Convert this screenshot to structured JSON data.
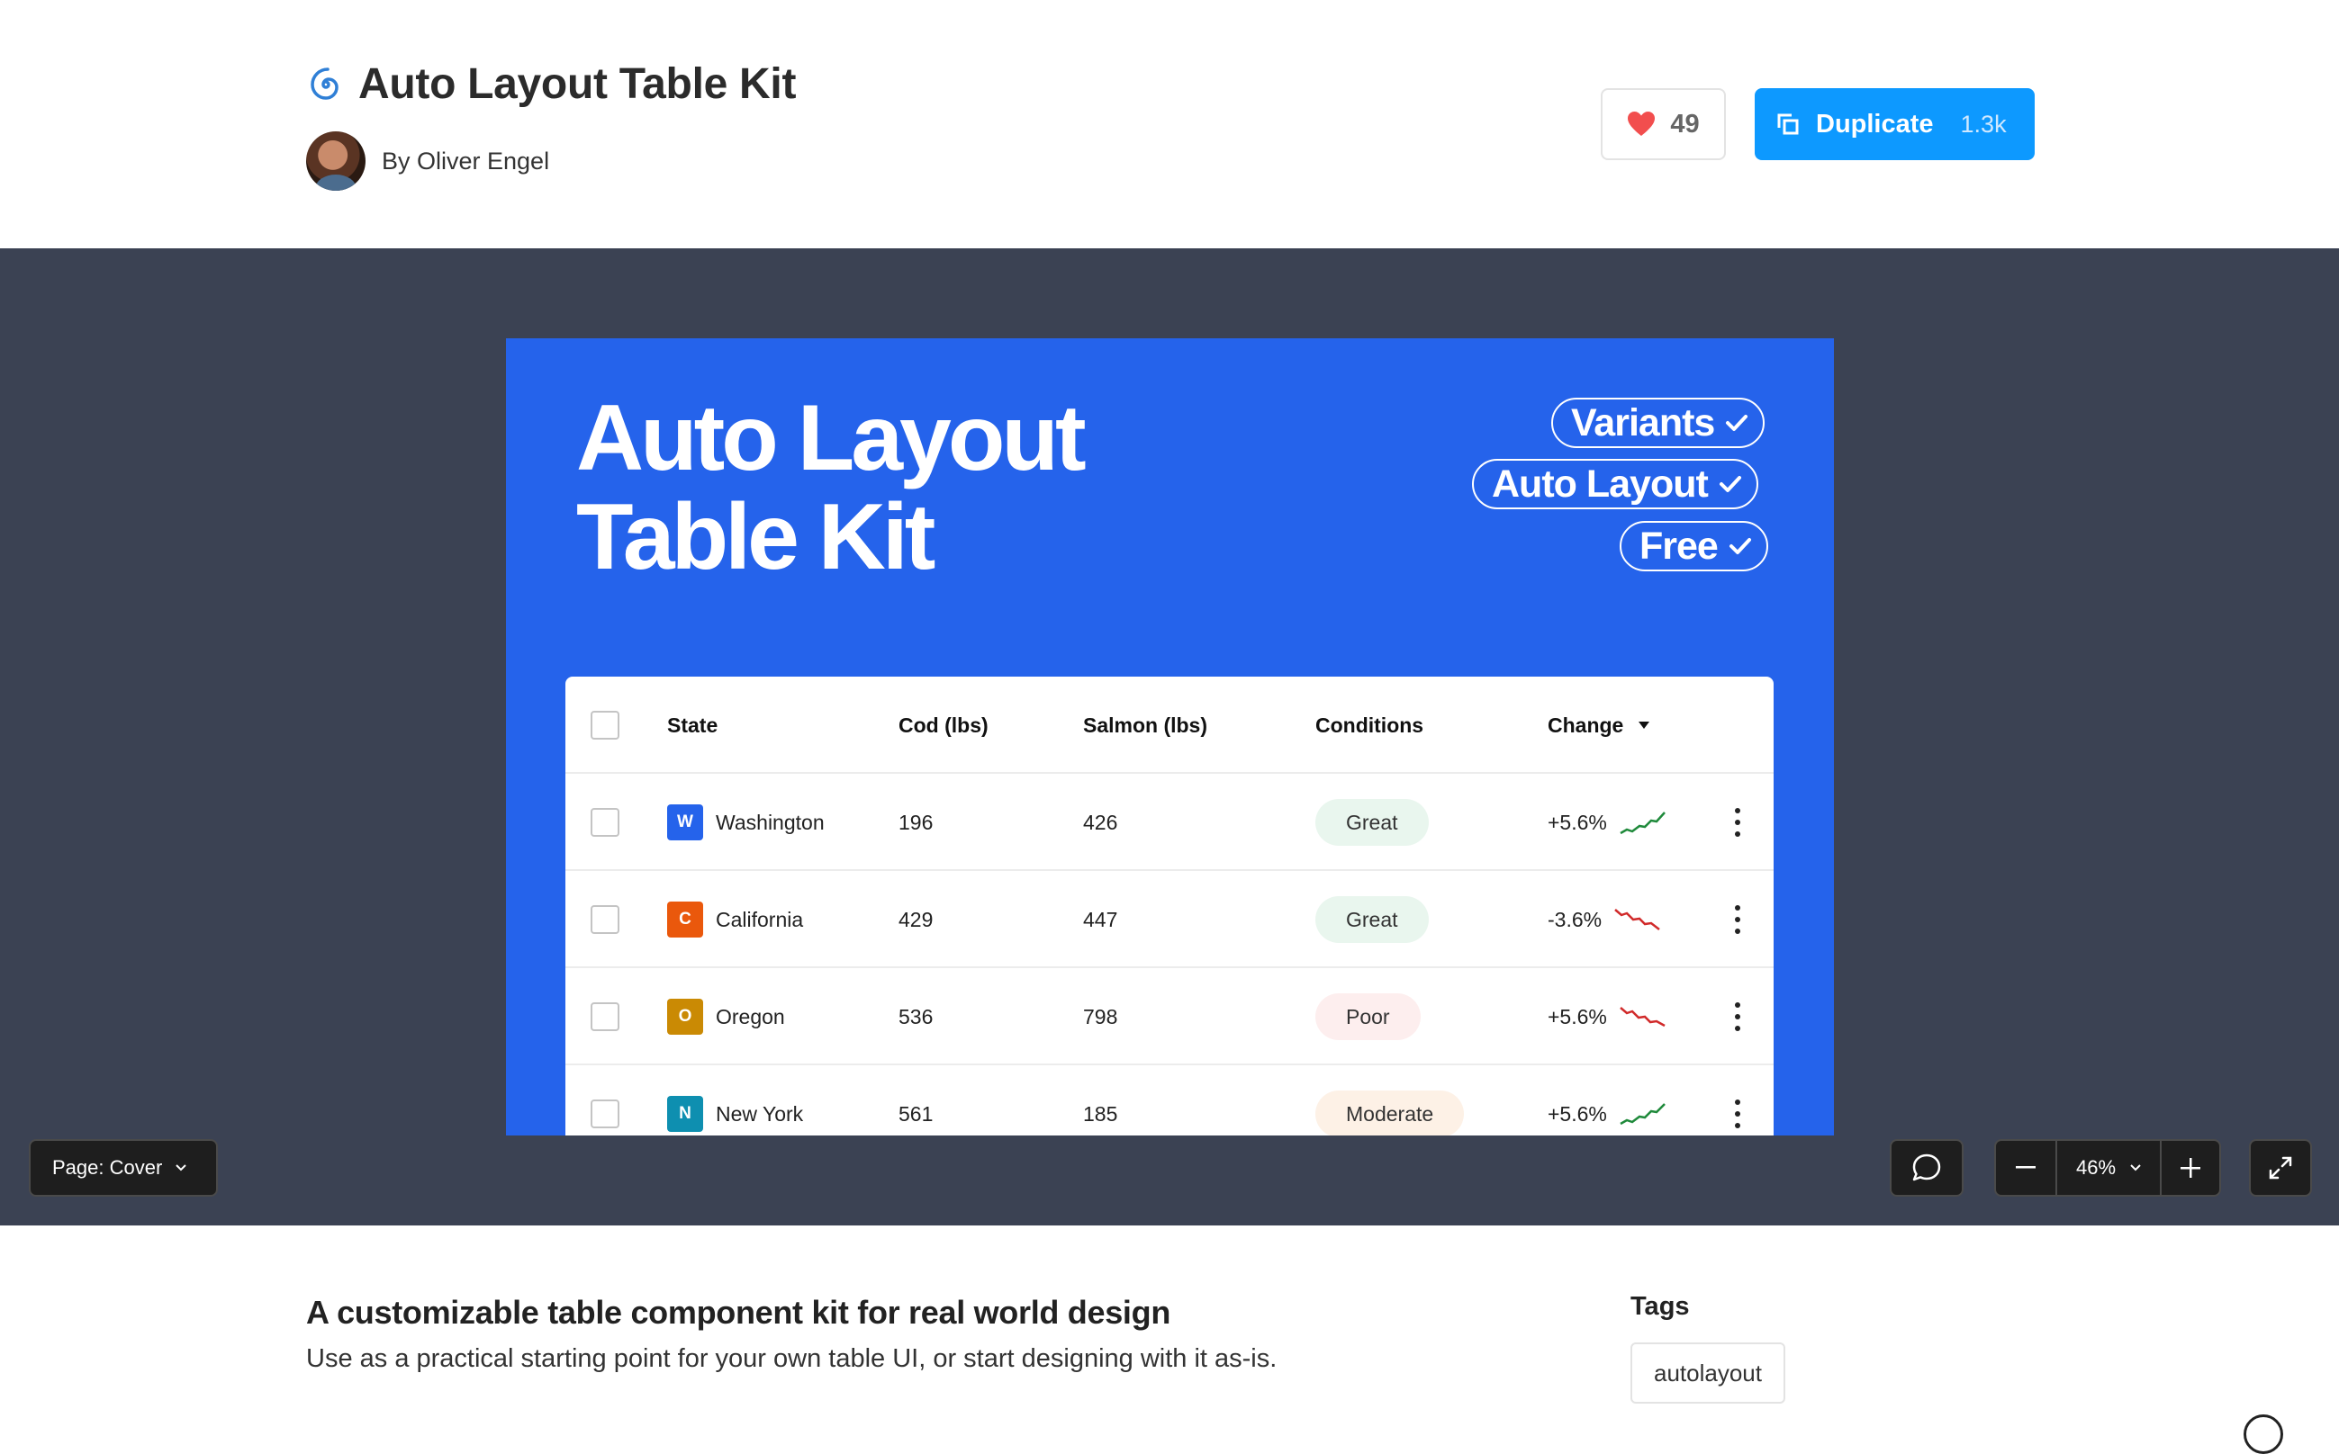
{
  "header": {
    "title": "Auto Layout Table Kit",
    "author": "By Oliver Engel",
    "likes": "49",
    "duplicate_label": "Duplicate",
    "duplicate_count": "1.3k"
  },
  "cover": {
    "title_line1": "Auto Layout",
    "title_line2": "Table Kit",
    "pills": [
      "Variants",
      "Auto Layout",
      "Free"
    ],
    "accent_color": "#2563eb"
  },
  "table": {
    "headers": [
      "State",
      "Cod (lbs)",
      "Salmon (lbs)",
      "Conditions",
      "Change"
    ],
    "rows": [
      {
        "badge": "W",
        "state": "Washington",
        "cod": "196",
        "salmon": "426",
        "condition": "Great",
        "change": "+5.6%",
        "trend": "up"
      },
      {
        "badge": "C",
        "state": "California",
        "cod": "429",
        "salmon": "447",
        "condition": "Great",
        "change": "-3.6%",
        "trend": "down"
      },
      {
        "badge": "O",
        "state": "Oregon",
        "cod": "536",
        "salmon": "798",
        "condition": "Poor",
        "change": "+5.6%",
        "trend": "down"
      },
      {
        "badge": "N",
        "state": "New York",
        "cod": "561",
        "salmon": "185",
        "condition": "Moderate",
        "change": "+5.6%",
        "trend": "up"
      }
    ]
  },
  "canvas_controls": {
    "page_label": "Page: Cover",
    "zoom": "46%"
  },
  "description": {
    "title": "A customizable table component kit for real world design",
    "text": "Use as a practical starting point for your own table UI, or start designing with it as-is."
  },
  "tags": {
    "heading": "Tags",
    "items": [
      "autolayout"
    ]
  }
}
